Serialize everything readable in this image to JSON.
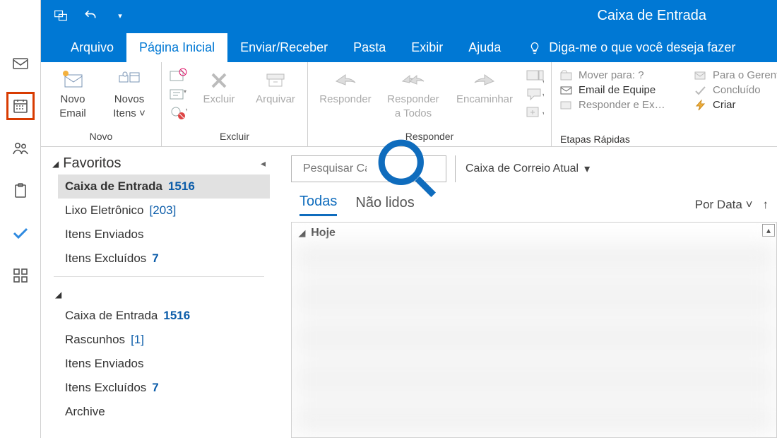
{
  "window_title": "Caixa de Entrada",
  "tabs": {
    "arquivo": "Arquivo",
    "inicio": "Página Inicial",
    "enviar": "Enviar/Receber",
    "pasta": "Pasta",
    "exibir": "Exibir",
    "ajuda": "Ajuda",
    "tellme": "Diga-me o que você deseja fazer"
  },
  "ribbon": {
    "novo": {
      "label": "Novo",
      "novo_email_1": "Novo",
      "novo_email_2": "Email",
      "novos_itens_1": "Novos",
      "novos_itens_2": "Itens ˅"
    },
    "excluir": {
      "label": "Excluir",
      "excluir": "Excluir",
      "arquivar": "Arquivar"
    },
    "responder": {
      "label": "Responder",
      "responder": "Responder",
      "responder_todos_1": "Responder",
      "responder_todos_2": "a Todos",
      "encaminhar": "Encaminhar"
    },
    "etapas": {
      "label": "Etapas Rápidas",
      "items": [
        "Mover para: ?",
        "Email de Equipe",
        "Responder e Ex…",
        "Para o Gerente",
        "Concluído",
        "Criar"
      ]
    }
  },
  "nav": {
    "favoritos": "Favoritos",
    "folders_fav": [
      {
        "name": "Caixa de Entrada",
        "count": "1516",
        "selected": true
      },
      {
        "name": "Lixo Eletrônico",
        "bracket": "[203]"
      },
      {
        "name": "Itens Enviados"
      },
      {
        "name": "Itens Excluídos",
        "count": "7"
      }
    ],
    "folders_acct": [
      {
        "name": "Caixa de Entrada",
        "count": "1516"
      },
      {
        "name": "Rascunhos",
        "bracket": "[1]"
      },
      {
        "name": "Itens Enviados"
      },
      {
        "name": "Itens Excluídos",
        "count": "7"
      },
      {
        "name": "Archive"
      }
    ]
  },
  "list": {
    "search_placeholder": "Pesquisar Caixa de Correio Atual",
    "search_display": "Pesquisar Caixa de Co",
    "scope": "Caixa de Correio Atual",
    "filters": {
      "todas": "Todas",
      "nao_lidos": "Não lidos"
    },
    "sort": "Por Data",
    "group_today": "Hoje"
  }
}
